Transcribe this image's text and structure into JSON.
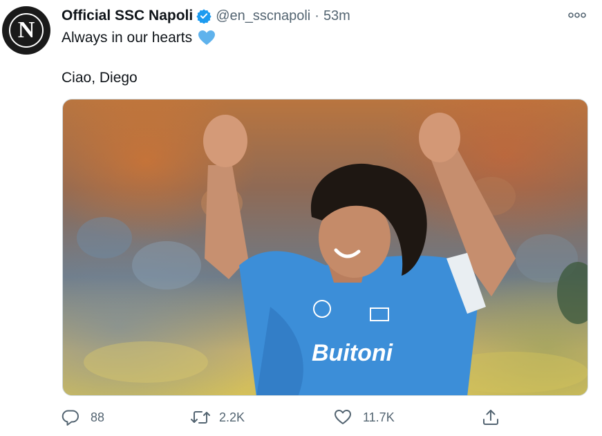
{
  "tweet": {
    "author": {
      "avatar_letter": "N",
      "name": "Official SSC Napoli",
      "handle": "@en_sscnapoli",
      "separator": "·",
      "time": "53m",
      "verified": true
    },
    "text_line1": "Always in our hearts",
    "text_line2": "Ciao, Diego",
    "emoji": "blue-heart-icon",
    "media": {
      "description": "photo",
      "shirt_text": "Buitoni"
    }
  },
  "actions": {
    "reply_count": "88",
    "retweet_count": "2.2K",
    "like_count": "11.7K"
  },
  "colors": {
    "verified_blue": "#1d9bf0",
    "muted_gray": "#536471",
    "heart_blue": "#5fb2ec",
    "shirt_blue": "#3c8ed8"
  },
  "icons": {
    "more": "more-dots-icon",
    "reply": "reply-bubble-icon",
    "retweet": "retweet-icon",
    "like": "heart-outline-icon",
    "share": "share-upload-icon"
  }
}
